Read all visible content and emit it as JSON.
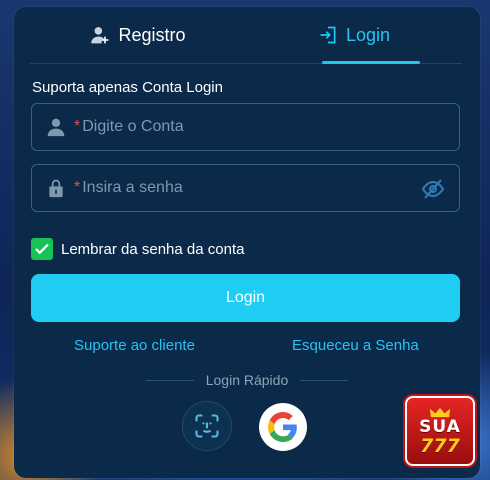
{
  "tabs": [
    {
      "label": "Registro",
      "icon": "add-user-icon",
      "active": false
    },
    {
      "label": "Login",
      "icon": "login-icon",
      "active": true
    }
  ],
  "form": {
    "section_label": "Suporta apenas Conta Login",
    "account_placeholder": "Digite o Conta",
    "password_placeholder": "Insira a senha",
    "required_mark": "*",
    "remember_label": "Lembrar da senha da conta",
    "remember_checked": true,
    "login_button": "Login"
  },
  "links": {
    "support": "Suporte ao cliente",
    "forgot": "Esqueceu a Senha"
  },
  "quick_login": {
    "label": "Login Rápido",
    "options": [
      "face-id-icon",
      "google-icon"
    ]
  },
  "brand": {
    "top": "SUA",
    "num": "777"
  },
  "colors": {
    "accent": "#22c7f0",
    "panel": "#0b2a4a",
    "checkbox": "#17c256",
    "required": "#e64a4a"
  }
}
